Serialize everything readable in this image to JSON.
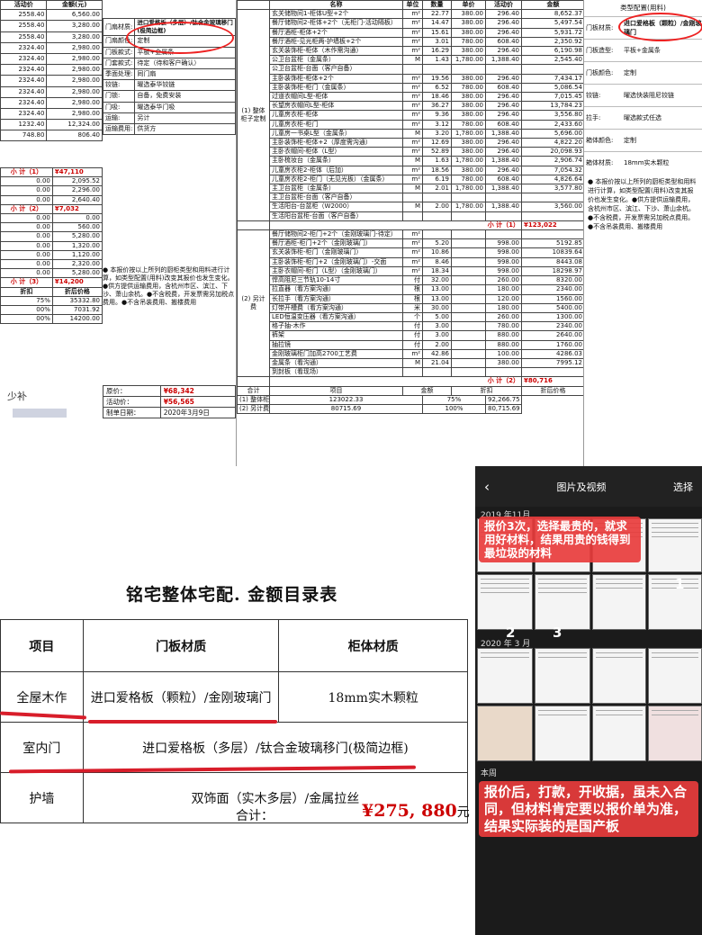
{
  "doc1": {
    "col_headers": [
      "活动价",
      "金额(元)"
    ],
    "grid_rows": [
      [
        "2558.40",
        "6,560.00"
      ],
      [
        "2558.40",
        "3,280.00"
      ],
      [
        "2558.40",
        "3,280.00"
      ],
      [
        "2324.40",
        "2,980.00"
      ],
      [
        "2324.40",
        "2,980.00"
      ],
      [
        "2324.40",
        "2,980.00"
      ],
      [
        "2324.40",
        "2,980.00"
      ],
      [
        "2324.40",
        "2,980.00"
      ],
      [
        "2324.40",
        "2,980.00"
      ],
      [
        "2324.40",
        "2,980.00"
      ],
      [
        "1232.40",
        "12,324.00"
      ],
      [
        "748.80",
        "806.40"
      ]
    ],
    "side_rows": [
      [
        "门扇材质:",
        "进口爱格板（多层）/钛合金玻璃移门(极简边框)"
      ],
      [
        "门扇颜色:",
        "定制"
      ],
      [
        "门板款式:",
        "平板+金属条"
      ],
      [
        "门套款式:",
        "待定（待和客户确认）"
      ],
      [
        "季面处理:",
        "同门扇"
      ],
      [
        "铰链:",
        "曜选泰华铰链"
      ],
      [
        "门锁:",
        "自备，免费安装"
      ],
      [
        "门吸:",
        "曜选泰华门吸"
      ],
      [
        "运输:",
        "另计"
      ],
      [
        "运输费用:",
        "供货方"
      ]
    ],
    "subtotal1_label": "小 计（1）",
    "subtotal1_value": "¥47,110",
    "block2_rows": [
      [
        "0.00",
        "2,095.52"
      ],
      [
        "0.00",
        "2,296.00"
      ],
      [
        "0.00",
        "2,640.40"
      ]
    ],
    "subtotal2_label": "小 计（2）",
    "subtotal2_value": "¥7,032",
    "block3_rows": [
      [
        "0.00",
        "0.00"
      ],
      [
        "0.00",
        "560.00"
      ],
      [
        "0.00",
        "5,280.00"
      ],
      [
        "0.00",
        "1,320.00"
      ],
      [
        "0.00",
        "1,120.00"
      ],
      [
        "0.00",
        "2,320.00"
      ],
      [
        "0.00",
        "5,280.00"
      ]
    ],
    "subtotal3_label": "小 计（3）",
    "subtotal3_value": "¥14,200",
    "discount_headers": [
      "折扣",
      "折后价格"
    ],
    "discount_rows": [
      [
        "75%",
        "35332.80"
      ],
      [
        "00%",
        "7031.92"
      ],
      [
        "00%",
        "14200.00"
      ]
    ],
    "note": "● 本报价按以上所列的厨柜类型和用料进行计算，如类型配置(用料)改变其报价也发生变化。●供方提供运输费用，含杭州市区、滨江、下沙、萧山余杭。●不含税费，开发票需另加税点费用。●不含吊装费用、搬楼费用",
    "price_label": "原价：",
    "price_value": "¥68,342",
    "promo_label": "活动价：",
    "promo_value": "¥56,565",
    "date_label": "制单日期：",
    "date_value": "2020年3月9日",
    "handwritten": "少补"
  },
  "doc2": {
    "headers": [
      "名称",
      "单位",
      "数量",
      "单价",
      "活动价",
      "金额"
    ],
    "group1_label": "(1) 整体柜子定制",
    "group1_rows": [
      [
        "玄关储物间1-柜体U型+2个",
        "m²",
        "22.77",
        "380.00",
        "296.40",
        "8,652.37"
      ],
      [
        "餐厅储物间2-柜体+2个（无柜门-活动隔板）",
        "m²",
        "14.47",
        "380.00",
        "296.40",
        "5,497.54"
      ],
      [
        "餐厅酒柜-柜体+2个",
        "m²",
        "15.61",
        "380.00",
        "296.40",
        "5,931.72"
      ],
      [
        "餐厅酒柜-见光柜两-护墙板+2个",
        "m²",
        "3.01",
        "780.00",
        "608.40",
        "2,350.92"
      ],
      [
        "玄关装饰柜-柜体（木作需沟通）",
        "m²",
        "16.29",
        "380.00",
        "296.40",
        "6,190.98"
      ],
      [
        "公卫台盆柜（金属条）",
        "M",
        "1.43",
        "1,780.00",
        "1,388.40",
        "2,545.40"
      ],
      [
        "公卫台盆柜-台面（客户自备）",
        "",
        "",
        "",
        "",
        ""
      ],
      [
        "主卧装饰柜-柜体+2个",
        "m²",
        "19.56",
        "380.00",
        "296.40",
        "7,434.17"
      ],
      [
        "主卧装饰柜-柜门（金属条）",
        "m²",
        "6.52",
        "780.00",
        "608.40",
        "5,086.54"
      ],
      [
        "过道衣帽间L型-柜体",
        "m²",
        "18.46",
        "380.00",
        "296.40",
        "7,015.45"
      ],
      [
        "长望房衣帽间L型-柜体",
        "m²",
        "36.27",
        "380.00",
        "296.40",
        "13,784.23"
      ],
      [
        "儿童房衣柜-柜体",
        "m²",
        "9.36",
        "380.00",
        "296.40",
        "3,556.80"
      ],
      [
        "儿童房衣柜-柜门",
        "m²",
        "3.12",
        "780.00",
        "608.40",
        "2,433.60"
      ],
      [
        "儿童房一书桌L型（金属条）",
        "M",
        "3.20",
        "1,780.00",
        "1,388.40",
        "5,696.00"
      ],
      [
        "主卧装饰柜-柜体+2（厚度需沟通）",
        "m²",
        "12.69",
        "380.00",
        "296.40",
        "4,822.20"
      ],
      [
        "主卧衣帽间-柜体（L型）",
        "m²",
        "52.89",
        "380.00",
        "296.40",
        "20,098.93"
      ],
      [
        "主卧梳妆台（金属条）",
        "M",
        "1.63",
        "1,780.00",
        "1,388.40",
        "2,906.74"
      ],
      [
        "儿童房衣柜2-柜体（后加）",
        "m²",
        "18.56",
        "380.00",
        "296.40",
        "7,054.32"
      ],
      [
        "儿童房衣柜2-柜门（无见光板）（金属条）",
        "m²",
        "6.19",
        "780.00",
        "608.40",
        "4,826.64"
      ],
      [
        "主卫台盆柜（金属条）",
        "M",
        "2.01",
        "1,780.00",
        "1,388.40",
        "3,577.80"
      ],
      [
        "主卫台盆柜-台面（客户自备）",
        "",
        "",
        "",
        "",
        ""
      ],
      [
        "生活阳台-台盆柜（W2000）",
        "M",
        "2.00",
        "1,780.00",
        "1,388.40",
        "3,560.00"
      ],
      [
        "生活阳台盆柜-台面（客户自备）",
        "",
        "",
        "",
        "",
        ""
      ]
    ],
    "subtotal1_label": "小 计（1）",
    "subtotal1_value": "¥123,022",
    "group2_label": "(2) 另计费",
    "group2_rows": [
      [
        "餐厅储物间2-柜门+2个（金刚玻璃门-待定）",
        "m²",
        "",
        "",
        "",
        ""
      ],
      [
        "餐厅酒柜-柜门+2个（金刚玻璃门）",
        "m²",
        "5.20",
        "",
        "998.00",
        "5192.85"
      ],
      [
        "玄关装饰柜-柜门（金刚玻璃门）",
        "m²",
        "10.86",
        "",
        "998.00",
        "10839.64"
      ],
      [
        "主卧装饰柜-柜门+2（金刚玻璃门）-交面",
        "m²",
        "8.46",
        "",
        "998.00",
        "8443.08"
      ],
      [
        "主卧衣帽间-柜门（L型）（金刚玻璃门）",
        "m²",
        "18.34",
        "",
        "998.00",
        "18298.97"
      ],
      [
        "悍高阻尼三节轨10-14寸",
        "付",
        "32.00",
        "",
        "260.00",
        "8320.00"
      ],
      [
        "拉直器（看方案沟通）",
        "根",
        "13.00",
        "",
        "180.00",
        "2340.00"
      ],
      [
        "长拉手（看方案沟通）",
        "根",
        "13.00",
        "",
        "120.00",
        "1560.00"
      ],
      [
        "灯带开槽费（看方案沟通）",
        "米",
        "30.00",
        "",
        "180.00",
        "5400.00"
      ],
      [
        "LED恒温变压器（看方案沟通）",
        "个",
        "5.00",
        "",
        "260.00",
        "1300.00"
      ],
      [
        "格子抽-木作",
        "付",
        "3.00",
        "",
        "780.00",
        "2340.00"
      ],
      [
        "裤架",
        "付",
        "3.00",
        "",
        "880.00",
        "2640.00"
      ],
      [
        "抽拉镜",
        "付",
        "2.00",
        "",
        "880.00",
        "1760.00"
      ],
      [
        "金刚玻璃柜门加高2700工艺费",
        "m²",
        "42.86",
        "",
        "100.00",
        "4286.03"
      ],
      [
        "金属条（看沟通）",
        "M",
        "21.04",
        "",
        "380.00",
        "7995.12"
      ],
      [
        "到封板（看现场）",
        "",
        "",
        "",
        "",
        ""
      ]
    ],
    "subtotal2_label": "小 计（2）",
    "subtotal2_value": "¥80,716",
    "total_label": "合计",
    "total_headers": [
      "项目",
      "金额",
      "折扣",
      "折后价格"
    ],
    "total_rows": [
      [
        "(1) 整体柜子定制",
        "123022.33",
        "75%",
        "92,266.75"
      ],
      [
        "(2) 另计费",
        "80715.69",
        "100%",
        "80,715.69"
      ]
    ]
  },
  "doc3": {
    "header": "类型配置(用料)",
    "rows": [
      [
        "门板材质:",
        "进口爱格板（颗粒）/金刚玻璃门"
      ],
      [
        "门板造型:",
        "平板+金属条"
      ],
      [
        "门板颜色:",
        "定制"
      ],
      [
        "铰链:",
        "曜选快装阻尼铰链"
      ],
      [
        "拉手:",
        "曜选款式任选"
      ],
      [
        "箱体颜色:",
        "定制"
      ],
      [
        "箱体材质:",
        "18mm实木颗粒"
      ]
    ],
    "note": "● 本报价按以上所列的厨柜类型和用料进行计算，如类型配置(用料)改变其报价也发生变化。●供方提供运输费用，含杭州市区、滨江、下沙、萧山余杭。●不含税费，开发票需另加税点费用。●不含吊装费用、搬楼费用"
  },
  "doc4": {
    "title": "铭宅整体宅配. 金额目录表",
    "headers": [
      "项目",
      "门板材质",
      "柜体材质"
    ],
    "rows": [
      [
        "全屋木作",
        "进口爱格板（颗粒）/金刚玻璃门",
        "18mm实木颗粒"
      ],
      [
        "室内门",
        "进口爱格板（多层）/钛合金玻璃移门(极简边框)",
        ""
      ],
      [
        "护墙",
        "双饰面（实木多层）/金属拉丝",
        ""
      ]
    ],
    "total_label": "合计：",
    "total_value": "¥275, 880",
    "total_suffix": "元"
  },
  "phone": {
    "back_icon": "chevron-left-icon",
    "title": "图片及视频",
    "select_label": "选择",
    "section1": "2019 年11月",
    "section2": "2020 年 3 月",
    "section3": "本周",
    "callout1": "报价3次，选择最贵的，就求用好材料，结果用贵的钱得到最垃圾的材料",
    "callout2": "报价后，打款，开收据，虽未入合同，但材料肯定要以报价单为准，结果实际装的是国产板",
    "num1": "1",
    "num2": "2",
    "num3": "3",
    "accent": "#e23c3c"
  }
}
